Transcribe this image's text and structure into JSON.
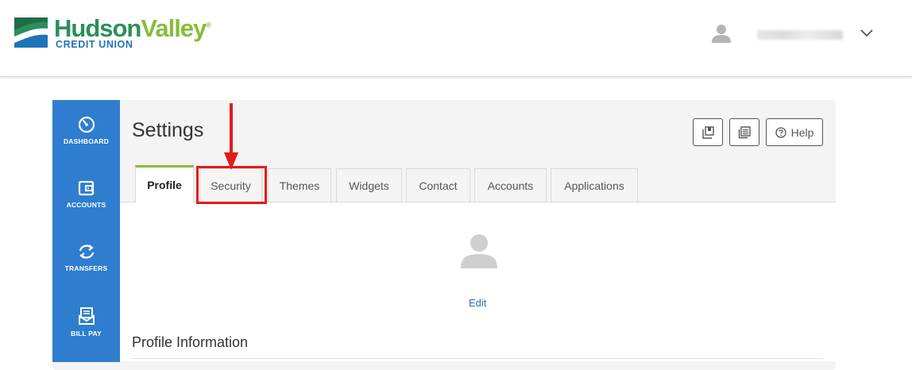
{
  "header": {
    "logo": {
      "name_part1": "Hudson",
      "name_part2": "Valley",
      "trademark": "®",
      "subtitle": "CREDIT UNION"
    },
    "user_icon": "user-icon",
    "menu_icon": "chevron-down-icon"
  },
  "sidebar": {
    "items": [
      {
        "label": "DASHBOARD",
        "icon": "gauge-icon"
      },
      {
        "label": "ACCOUNTS",
        "icon": "wallet-icon"
      },
      {
        "label": "TRANSFERS",
        "icon": "transfer-icon"
      },
      {
        "label": "BILL PAY",
        "icon": "bill-icon"
      }
    ]
  },
  "page": {
    "title": "Settings",
    "toolbar": {
      "help_label": "Help"
    }
  },
  "tabs": [
    {
      "label": "Profile",
      "active": true
    },
    {
      "label": "Security",
      "active": false
    },
    {
      "label": "Themes",
      "active": false
    },
    {
      "label": "Widgets",
      "active": false
    },
    {
      "label": "Contact",
      "active": false
    },
    {
      "label": "Accounts",
      "active": false
    },
    {
      "label": "Applications",
      "active": false
    }
  ],
  "profile": {
    "edit_label": "Edit",
    "section_title": "Profile Information"
  },
  "colors": {
    "sidebar": "#2f7dcf",
    "accent_green": "#86bd3a",
    "annotation_red": "#e31b1b",
    "link_blue": "#2f6fa6"
  }
}
